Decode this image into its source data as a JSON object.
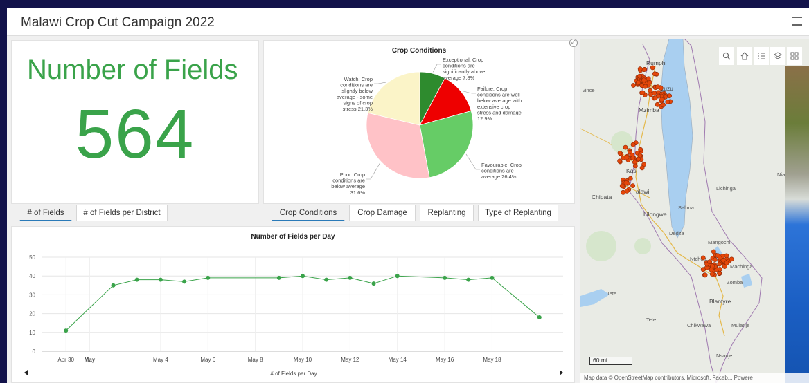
{
  "app": {
    "title": "Malawi Crop Cut Campaign 2022"
  },
  "indicator": {
    "title": "Number of Fields",
    "value": "564"
  },
  "left_tabs": [
    "# of Fields",
    "# of Fields per District"
  ],
  "pie": {
    "tabs": [
      "Crop Conditions",
      "Crop Damage",
      "Replanting",
      "Type of Replanting"
    ],
    "labels": {
      "exceptional": [
        "Exceptional: Crop",
        "conditions are",
        "significantly above",
        "average 7.8%"
      ],
      "failure": [
        "Failure: Crop",
        "conditions are well",
        "below average with",
        "extensive crop",
        "stress and damage",
        "12.9%"
      ],
      "favourable": [
        "Favourable: Crop",
        "conditions are",
        "average 26.4%"
      ],
      "poor": [
        "Poor: Crop",
        "conditions are",
        "below average",
        "31.6%"
      ],
      "watch": [
        "Watch: Crop",
        "conditions are",
        "slightly below",
        "average - some",
        "signs of crop",
        "stress 21.3%"
      ]
    }
  },
  "chart_data": [
    {
      "type": "pie",
      "title": "Crop Conditions",
      "slices": [
        {
          "label": "Exceptional: Crop conditions are significantly above average",
          "value": 7.8,
          "color": "#2e8b2e"
        },
        {
          "label": "Failure: Crop conditions are well below average with extensive crop stress and damage",
          "value": 12.9,
          "color": "#ee0000"
        },
        {
          "label": "Favourable: Crop conditions are average",
          "value": 26.4,
          "color": "#66cc66"
        },
        {
          "label": "Poor: Crop conditions are below average",
          "value": 31.6,
          "color": "#ffc2c7"
        },
        {
          "label": "Watch: Crop conditions are slightly below average - some signs of crop stress",
          "value": 21.3,
          "color": "#fbf4c8"
        }
      ]
    },
    {
      "type": "line",
      "title": "Number of Fields per Day",
      "xlabel": "# of Fields per Day",
      "ylim": [
        0,
        50
      ],
      "yticks": [
        0,
        10,
        20,
        30,
        40,
        50
      ],
      "xlim": [
        "2022-04-29",
        "2022-05-21"
      ],
      "xticks": [
        {
          "date": "2022-04-30",
          "label": "Apr 30",
          "bold": false
        },
        {
          "date": "2022-05-01",
          "label": "May",
          "bold": true
        },
        {
          "date": "2022-05-04",
          "label": "May 4",
          "bold": false
        },
        {
          "date": "2022-05-06",
          "label": "May 6",
          "bold": false
        },
        {
          "date": "2022-05-08",
          "label": "May 8",
          "bold": false
        },
        {
          "date": "2022-05-10",
          "label": "May 10",
          "bold": false
        },
        {
          "date": "2022-05-12",
          "label": "May 12",
          "bold": false
        },
        {
          "date": "2022-05-14",
          "label": "May 14",
          "bold": false
        },
        {
          "date": "2022-05-16",
          "label": "May 16",
          "bold": false
        },
        {
          "date": "2022-05-18",
          "label": "May 18",
          "bold": false
        }
      ],
      "color": "#3aa34a",
      "points": [
        {
          "x": "2022-04-30",
          "y": 11
        },
        {
          "x": "2022-05-02",
          "y": 35
        },
        {
          "x": "2022-05-03",
          "y": 38
        },
        {
          "x": "2022-05-04",
          "y": 38
        },
        {
          "x": "2022-05-05",
          "y": 37
        },
        {
          "x": "2022-05-06",
          "y": 39
        },
        {
          "x": "2022-05-09",
          "y": 39
        },
        {
          "x": "2022-05-10",
          "y": 40
        },
        {
          "x": "2022-05-11",
          "y": 38
        },
        {
          "x": "2022-05-12",
          "y": 39
        },
        {
          "x": "2022-05-13",
          "y": 36
        },
        {
          "x": "2022-05-14",
          "y": 40
        },
        {
          "x": "2022-05-16",
          "y": 39
        },
        {
          "x": "2022-05-17",
          "y": 38
        },
        {
          "x": "2022-05-18",
          "y": 39
        },
        {
          "x": "2022-05-20",
          "y": 18
        }
      ]
    }
  ],
  "map": {
    "labels": {
      "rumphi": "Rumphi",
      "mzuzu": "zuzu",
      "mzimba": "Mzimba",
      "vince": "vince",
      "lichinga": "Lichinga",
      "ni": "Nia",
      "kasungu": "Kas",
      "malawi": "alawi",
      "chipata": "Chipata",
      "salima": "Salima",
      "lilongwe": "Lilongwe",
      "dedza": "Dedza",
      "mangochi": "Mangochi",
      "ntcheu": "Ntcheu",
      "machinga": "Machinga",
      "zomba": "Zomba",
      "tete_top": "Tete",
      "blantyre": "Blantyre",
      "tete": "Tete",
      "chikwawa": "Chikwawa",
      "mulanje": "Mulanje",
      "nsanje": "Nsanje"
    },
    "scale": "60 mi",
    "attribution": "Map data © OpenStreetMap contributors, Microsoft, Faceb...   Powere",
    "tool_icons": [
      "search-icon",
      "home-icon",
      "legend-icon",
      "layers-icon",
      "basemap-gallery-icon"
    ],
    "colors": {
      "lake": "#a9cff0",
      "points": "#e5470a"
    }
  }
}
